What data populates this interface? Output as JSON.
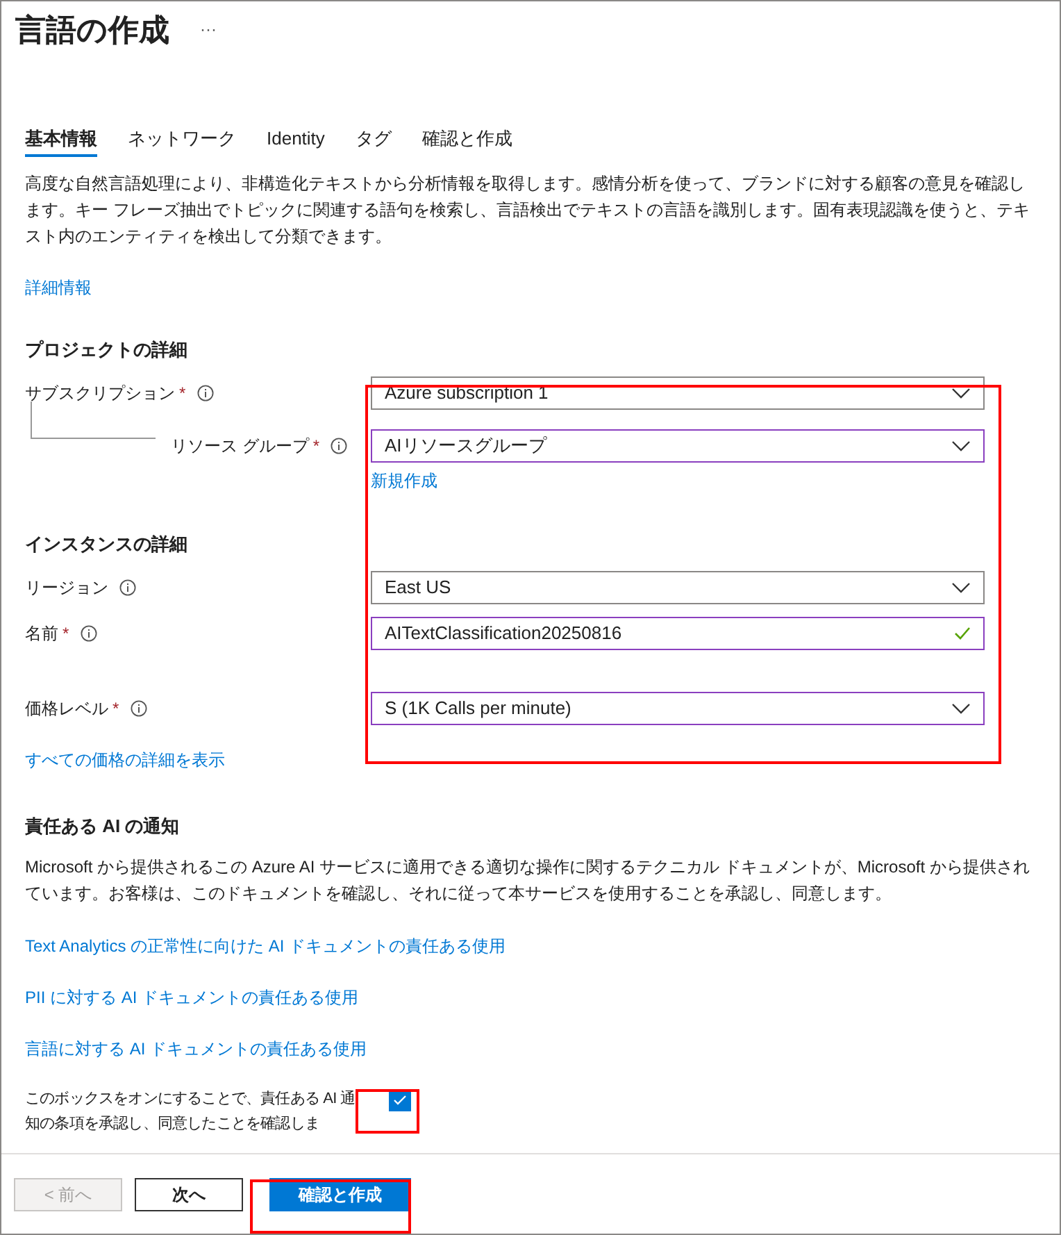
{
  "title": "言語の作成",
  "more": "···",
  "tabs": [
    {
      "label": "基本情報",
      "selected": true
    },
    {
      "label": "ネットワーク",
      "selected": false
    },
    {
      "label": "Identity",
      "selected": false
    },
    {
      "label": "タグ",
      "selected": false
    },
    {
      "label": "確認と作成",
      "selected": false
    }
  ],
  "description": "高度な自然言語処理により、非構造化テキストから分析情報を取得します。感情分析を使って、ブランドに対する顧客の意見を確認します。キー フレーズ抽出でトピックに関連する語句を検索し、言語検出でテキストの言語を識別します。固有表現認識を使うと、テキスト内のエンティティを検出して分類できます。",
  "more_info_link": "詳細情報",
  "sections": [
    {
      "heading": "プロジェクトの詳細",
      "fields": [
        {
          "label": "サブスクリプション",
          "required_mark": "*",
          "kind": "dropdown",
          "value": "Azure subscription 1",
          "modified": false,
          "children": [
            {
              "label": "リソース グループ",
              "required_mark": "*",
              "kind": "dropdown",
              "value": "AIリソースグループ",
              "modified": true,
              "link": "新規作成"
            }
          ]
        }
      ]
    },
    {
      "heading": "インスタンスの詳細",
      "fields": [
        {
          "label": "リージョン",
          "kind": "dropdown",
          "value": "East US",
          "modified": false
        },
        {
          "label": "名前",
          "required_mark": "*",
          "kind": "text",
          "value": "AITextClassification20250816",
          "modified": true,
          "valid": true
        },
        {
          "label": "価格レベル",
          "required_mark": "*",
          "kind": "dropdown",
          "value": "S (1K Calls per minute)",
          "modified": true
        }
      ],
      "link": "すべての価格の詳細を表示"
    }
  ],
  "notice": {
    "heading": "責任ある AI の通知",
    "paragraph": "Microsoft から提供されるこの Azure AI サービスに適用できる適切な操作に関するテクニカル ドキュメントが、Microsoft から提供されています。お客様は、このドキュメントを確認し、それに従って本サービスを使用することを承認し、同意します。",
    "links": [
      "Text Analytics の正常性に向けた AI ドキュメントの責任ある使用",
      "PII に対する AI ドキュメントの責任ある使用",
      "言語に対する AI ドキュメントの責任ある使用"
    ],
    "checkbox": {
      "label": "このボックスをオンにすることで、責任ある AI 通知の条項を承認し、同意したことを確認しま",
      "checked": true
    }
  },
  "footer": [
    {
      "label": "< 前へ",
      "kind": "secondary",
      "disabled": true
    },
    {
      "label": "次へ",
      "kind": "secondary",
      "disabled": false
    },
    {
      "label": "確認と作成",
      "kind": "primary",
      "disabled": false
    }
  ]
}
